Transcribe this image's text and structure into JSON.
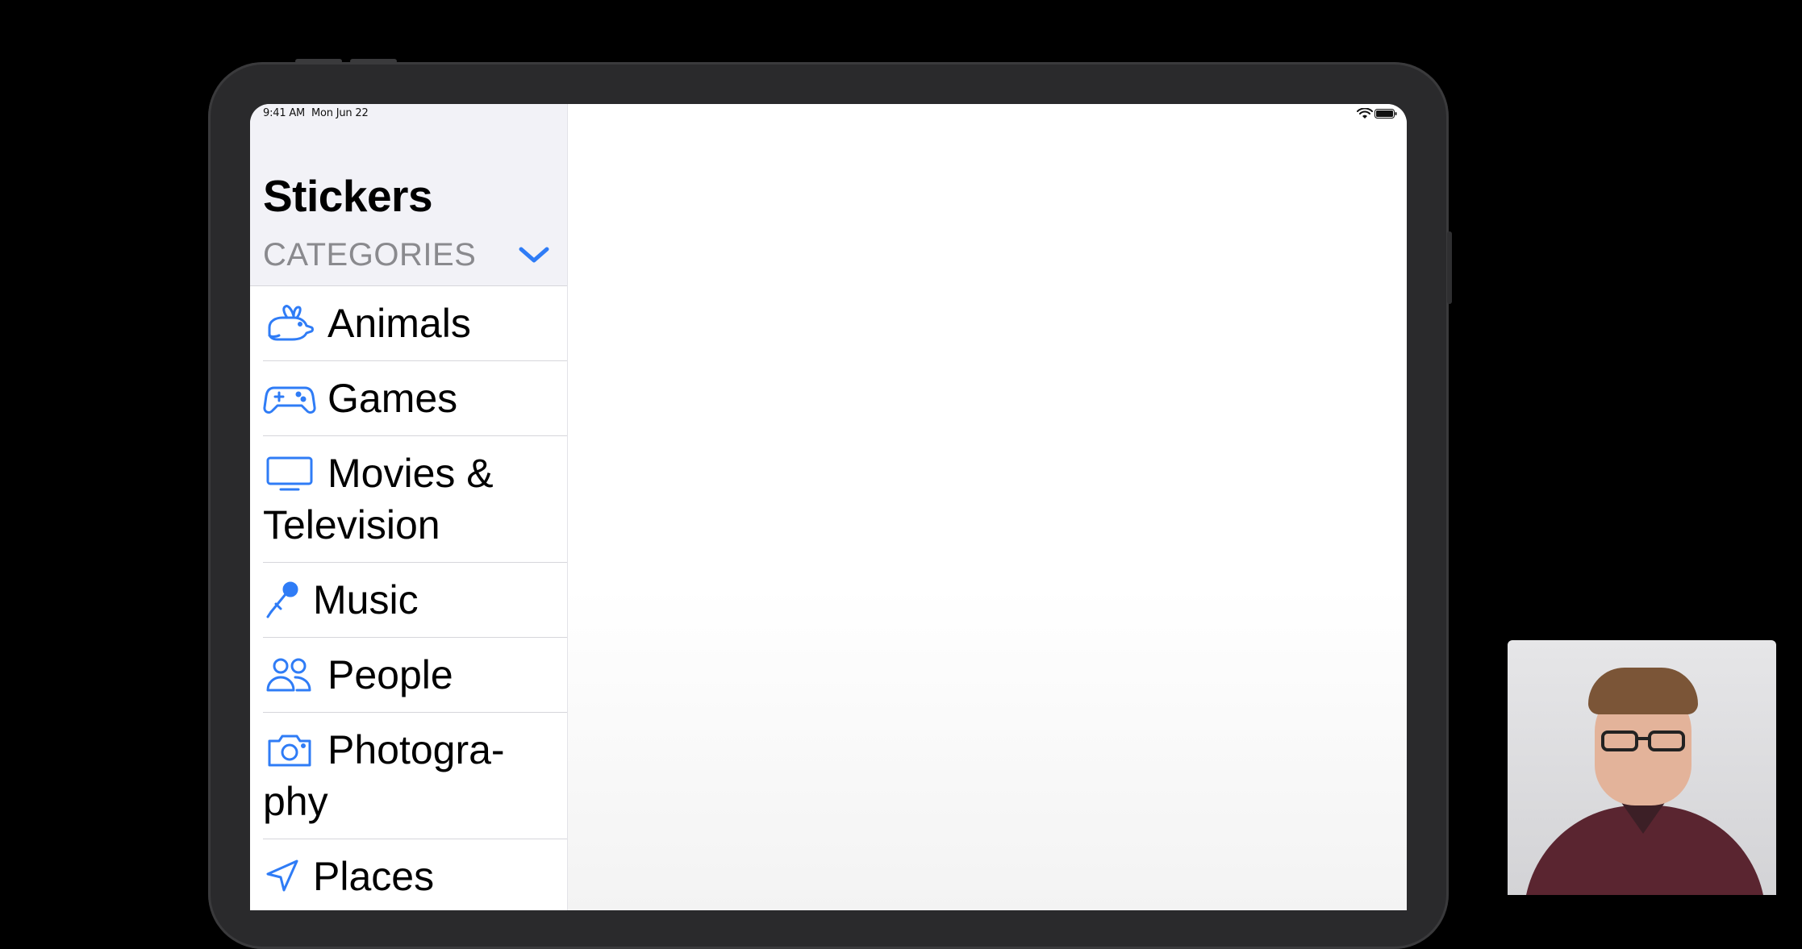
{
  "status_bar": {
    "time": "9:41 AM",
    "date": "Mon Jun 22",
    "wifi_icon": "wifi-icon",
    "battery_icon": "battery-icon"
  },
  "sidebar": {
    "title": "Stickers",
    "section_header": "CATEGORIES",
    "section_toggle_icon": "chevron-down-icon",
    "items": [
      {
        "label": "Animals",
        "icon": "rabbit-icon"
      },
      {
        "label": "Games",
        "icon": "gamecontroller-icon"
      },
      {
        "label": "Movies & Television",
        "icon": "tv-icon"
      },
      {
        "label": "Music",
        "icon": "microphone-icon"
      },
      {
        "label": "People",
        "icon": "people-icon"
      },
      {
        "label": "Photogra-phy",
        "icon": "camera-icon"
      },
      {
        "label": "Places",
        "icon": "location-arrow-icon"
      }
    ]
  },
  "colors": {
    "accent": "#2f7cf6",
    "sidebar_background": "#f2f2f7",
    "secondary_text": "#8a8a8e"
  }
}
